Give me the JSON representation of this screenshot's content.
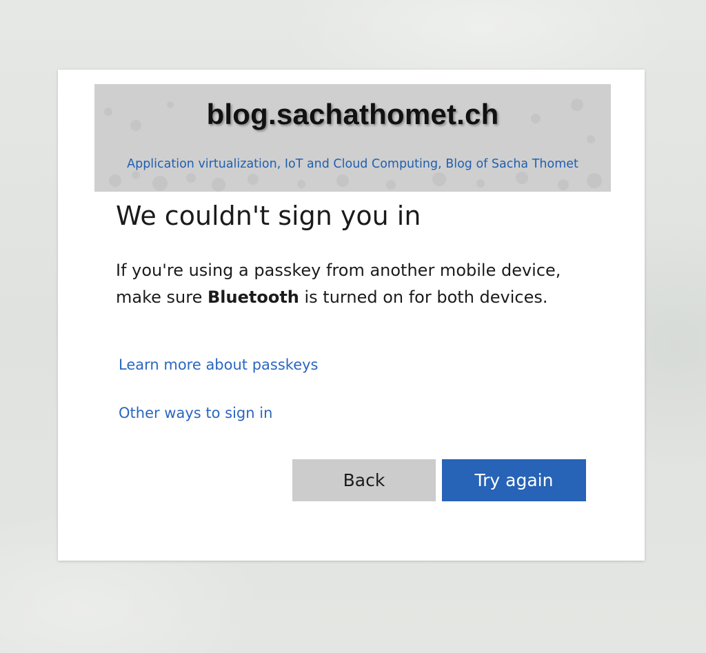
{
  "banner": {
    "title": "blog.sachathomet.ch",
    "subtitle": "Application virtualization, IoT and Cloud Computing, Blog of Sacha Thomet"
  },
  "dialog": {
    "heading": "We couldn't sign you in",
    "description_before": "If you're using a passkey from another mobile device, make sure ",
    "description_bold": "Bluetooth",
    "description_after": " is turned on for both devices.",
    "learn_more_link": "Learn more about passkeys",
    "other_ways_link": "Other ways to sign in",
    "back_button": "Back",
    "try_again_button": "Try again"
  },
  "colors": {
    "link": "#2a66c0",
    "primary_button": "#2763b6",
    "secondary_button": "#cccccc",
    "banner_background": "#cfcfcf"
  }
}
